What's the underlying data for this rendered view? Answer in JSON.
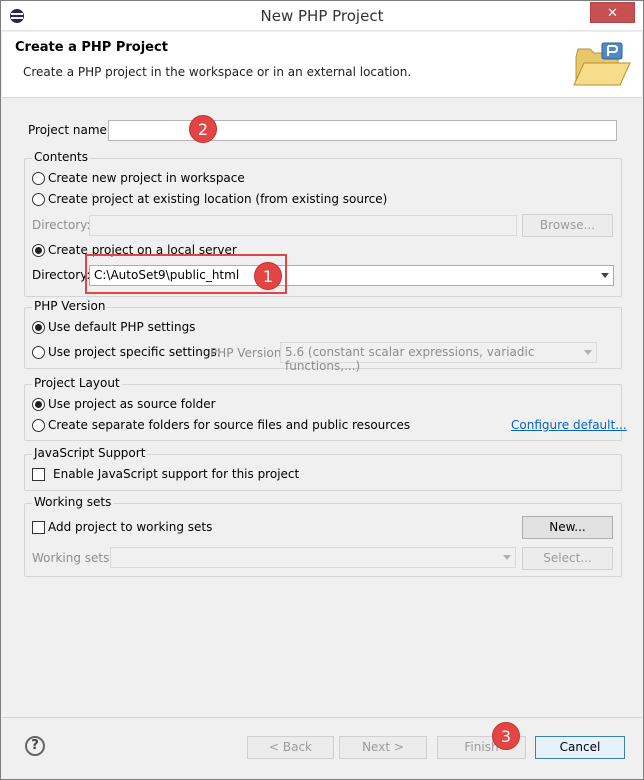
{
  "window": {
    "title": "New PHP Project",
    "close_label": "✕"
  },
  "banner": {
    "title": "Create a PHP Project",
    "description": "Create a PHP project in the workspace or in an external location."
  },
  "project_name": {
    "label": "Project name:",
    "value": ""
  },
  "contents": {
    "title": "Contents",
    "option_new": "Create new project in workspace",
    "option_existing": "Create project at existing location (from existing source)",
    "directory_label": "Directory:",
    "directory_disabled_value": "",
    "browse_label": "Browse...",
    "option_local_server": "Create project on a local server",
    "directory_value": "C:\\AutoSet9\\public_html",
    "selected": "local_server"
  },
  "php_version": {
    "title": "PHP Version",
    "option_default": "Use default PHP settings",
    "option_specific": "Use project specific settings:",
    "version_label": "PHP Version:",
    "version_value": "5.6 (constant scalar expressions, variadic functions,...)",
    "selected": "default"
  },
  "project_layout": {
    "title": "Project Layout",
    "option_source": "Use project as source folder",
    "option_separate": "Create separate folders for source files and public resources",
    "configure_link": "Configure default...",
    "selected": "source"
  },
  "javascript": {
    "title": "JavaScript Support",
    "checkbox_label": "Enable JavaScript support for this project",
    "checked": false
  },
  "working_sets": {
    "title": "Working sets",
    "checkbox_label": "Add project to working sets",
    "checked": false,
    "new_label": "New...",
    "sets_label": "Working sets:",
    "select_label": "Select..."
  },
  "footer": {
    "help_label": "?",
    "back_label": "< Back",
    "next_label": "Next >",
    "finish_label": "Finish",
    "cancel_label": "Cancel"
  },
  "annotations": {
    "badge_1": "1",
    "badge_2": "2",
    "badge_3": "3",
    "badge_color": "#e34545"
  }
}
